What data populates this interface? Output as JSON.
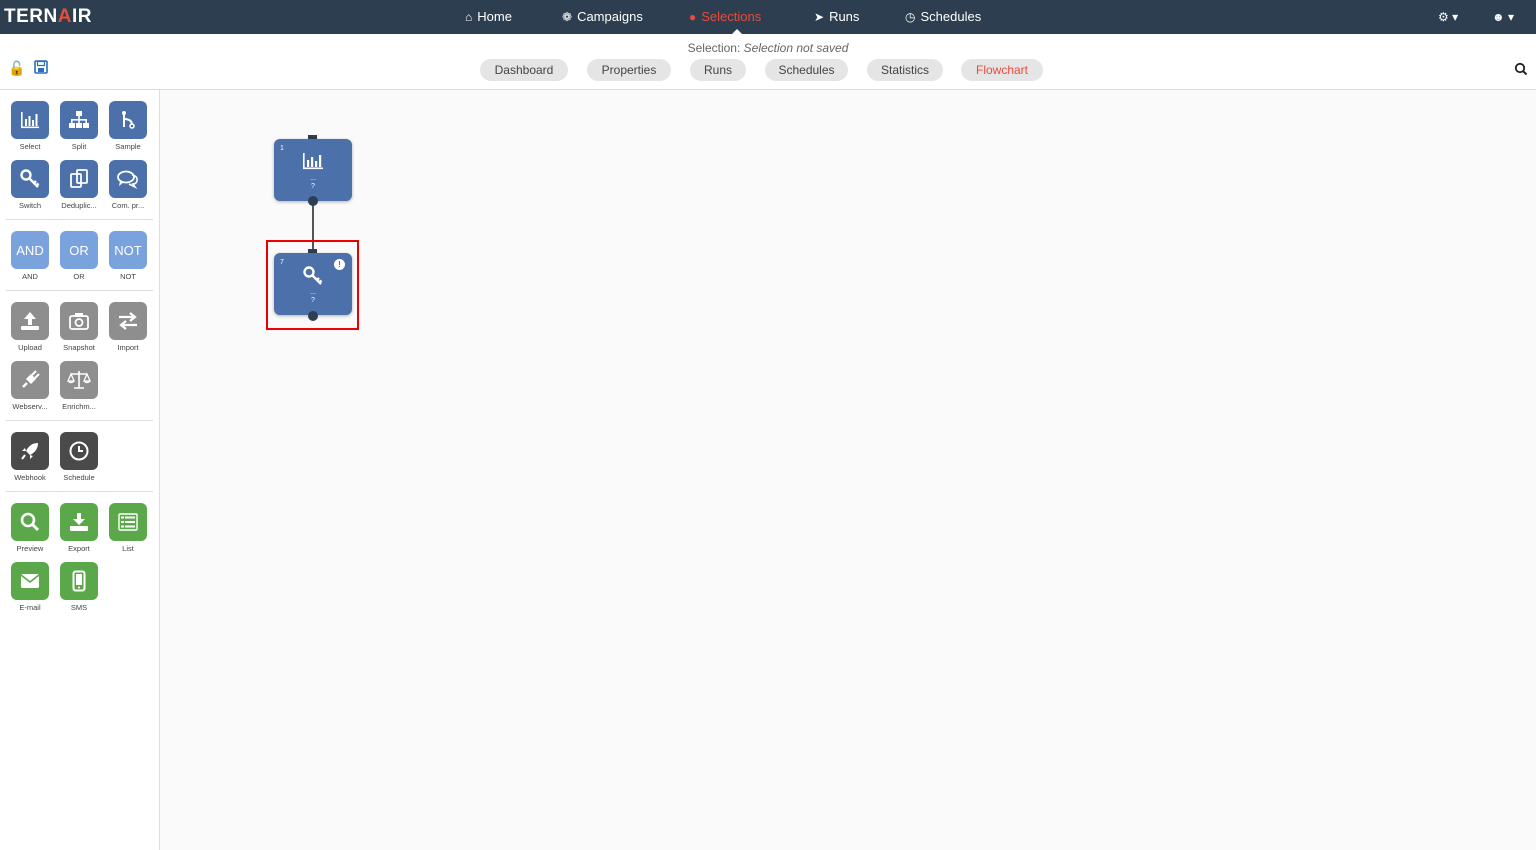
{
  "app": {
    "logo_a": "TERN",
    "logo_b": "A",
    "logo_c": "IR"
  },
  "nav": {
    "home": "Home",
    "campaigns": "Campaigns",
    "selections": "Selections",
    "runs": "Runs",
    "schedules": "Schedules"
  },
  "selection": {
    "label": "Selection:",
    "value": "Selection not saved"
  },
  "tabs": {
    "dashboard": "Dashboard",
    "properties": "Properties",
    "runs": "Runs",
    "schedules": "Schedules",
    "statistics": "Statistics",
    "flowchart": "Flowchart"
  },
  "tools": {
    "select": "Select",
    "split": "Split",
    "sample": "Sample",
    "switch": "Switch",
    "dedup": "Deduplic...",
    "compr": "Com. pr...",
    "and_btn": "AND",
    "and": "AND",
    "or_btn": "OR",
    "or": "OR",
    "not_btn": "NOT",
    "not": "NOT",
    "upload": "Upload",
    "snapshot": "Snapshot",
    "import": "Import",
    "webserv": "Webserv...",
    "enrich": "Enrichm...",
    "webhook": "Webhook",
    "schedule": "Schedule",
    "preview": "Preview",
    "export": "Export",
    "list": "List",
    "email": "E-mail",
    "sms": "SMS"
  },
  "nodes": [
    {
      "num": "1",
      "line1": "...",
      "line2": "?"
    },
    {
      "num": "7",
      "line1": "...",
      "line2": "?",
      "warning": "!"
    }
  ],
  "colors": {
    "accent": "#e74c3c",
    "node": "#4b70aa",
    "topbar": "#2c3e50"
  }
}
